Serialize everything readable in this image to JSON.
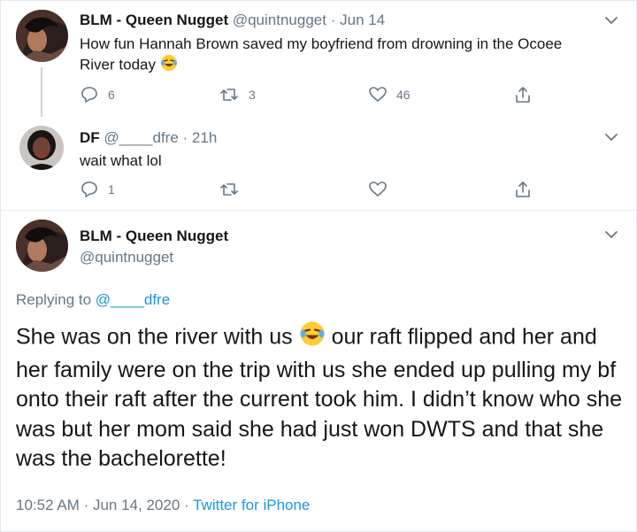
{
  "tweet1": {
    "display_name": "BLM - Queen Nugget",
    "handle": "@quintnugget",
    "separator": "·",
    "date": "Jun 14",
    "text_line1": "How fun Hannah Brown saved my boyfriend from drowning in the Ocoee",
    "text_line2": "River today",
    "emoji": "face-with-tears-of-joy",
    "reply_count": "6",
    "retweet_count": "3",
    "like_count": "46"
  },
  "tweet2": {
    "display_name": "DF",
    "handle": "@____dfre",
    "separator": "·",
    "date": "21h",
    "text": "wait what lol",
    "reply_count": "1"
  },
  "main_tweet": {
    "display_name": "BLM - Queen Nugget",
    "handle": "@quintnugget",
    "replying_prefix": "Replying to",
    "replying_handle": "@____dfre",
    "text_part1": "She was on the river with us",
    "emoji": "face-with-tears-of-joy",
    "text_part2": "our raft flipped and her and her family were on the trip with us she ended up pulling my bf onto their raft after the current took him. I didn’t know who she was but her mom said she had just won DWTS and that she was the bachelorette!",
    "time": "10:52 AM",
    "dot": "·",
    "date": "Jun 14, 2020",
    "source": "Twitter for iPhone"
  },
  "colors": {
    "text": "#14171a",
    "muted": "#657786",
    "link": "#1b95e0",
    "thread_line": "#ccd6dd"
  }
}
